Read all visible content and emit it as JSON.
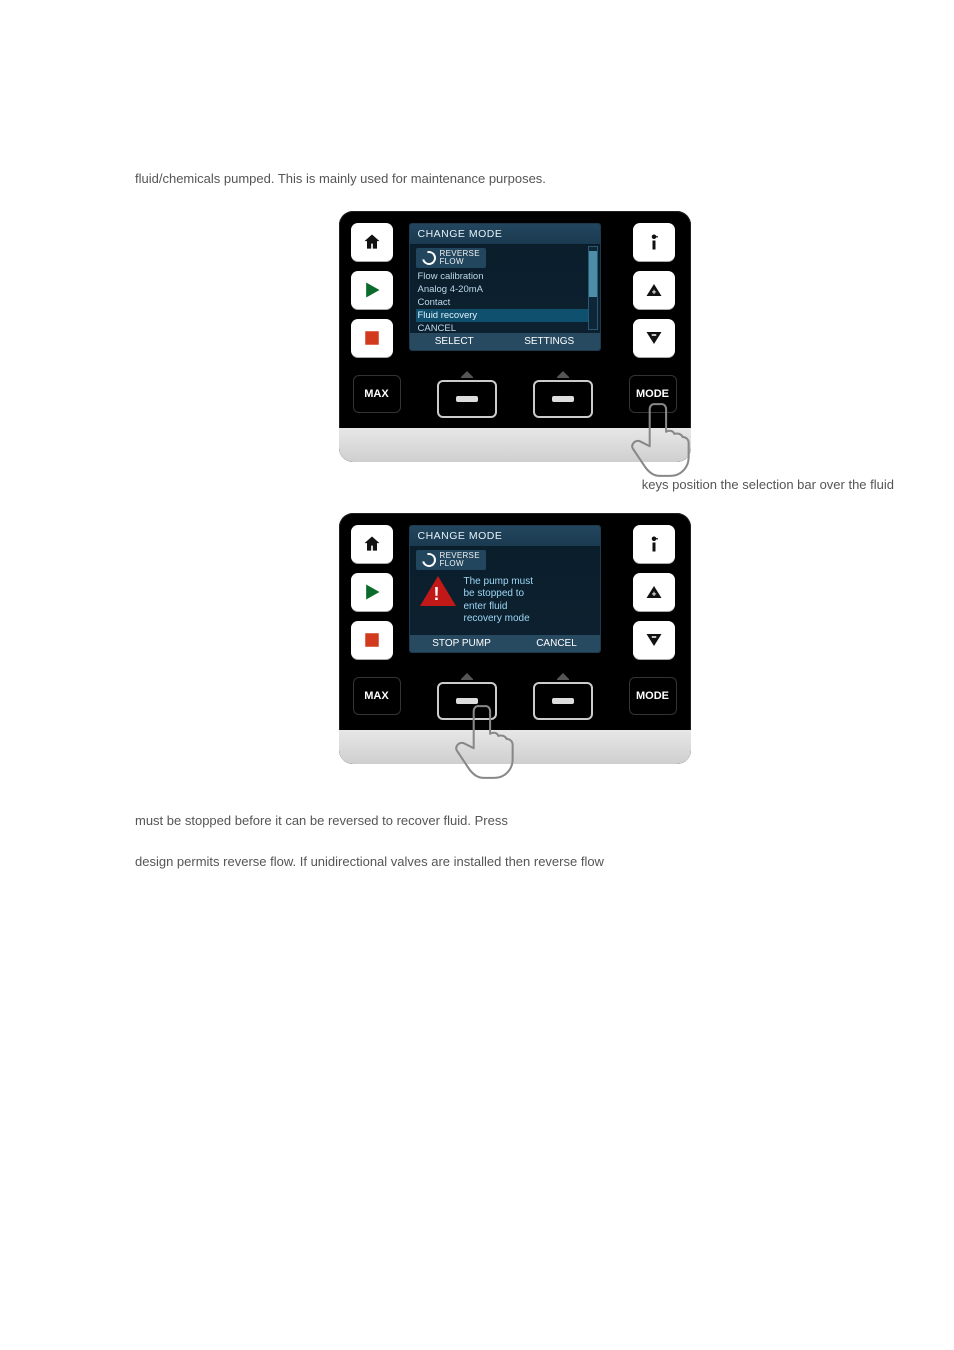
{
  "body": {
    "p1": "fluid/chemicals pumped. This is mainly used for maintenance purposes.",
    "caption1": "keys position the selection bar over the fluid",
    "p3": "must be stopped before it can be reversed to recover fluid.  Press",
    "p4": "design permits reverse flow. If unidirectional valves are installed then reverse flow"
  },
  "device1": {
    "title": "CHANGE MODE",
    "logo_top": "REVERSE",
    "logo_bot": "FLOW",
    "items": [
      "Flow calibration",
      "Analog 4-20mA",
      "Contact",
      "Fluid recovery",
      "CANCEL"
    ],
    "hl_index": 3,
    "soft_left": "SELECT",
    "soft_right": "SETTINGS",
    "key_left": "MAX",
    "key_right": "MODE"
  },
  "device2": {
    "title": "CHANGE MODE",
    "logo_top": "REVERSE",
    "logo_bot": "FLOW",
    "warn_lines": [
      "The pump must",
      "be stopped to",
      "enter fluid",
      "recovery mode"
    ],
    "soft_left": "STOP PUMP",
    "soft_right": "CANCEL",
    "key_left": "MAX",
    "key_right": "MODE"
  }
}
